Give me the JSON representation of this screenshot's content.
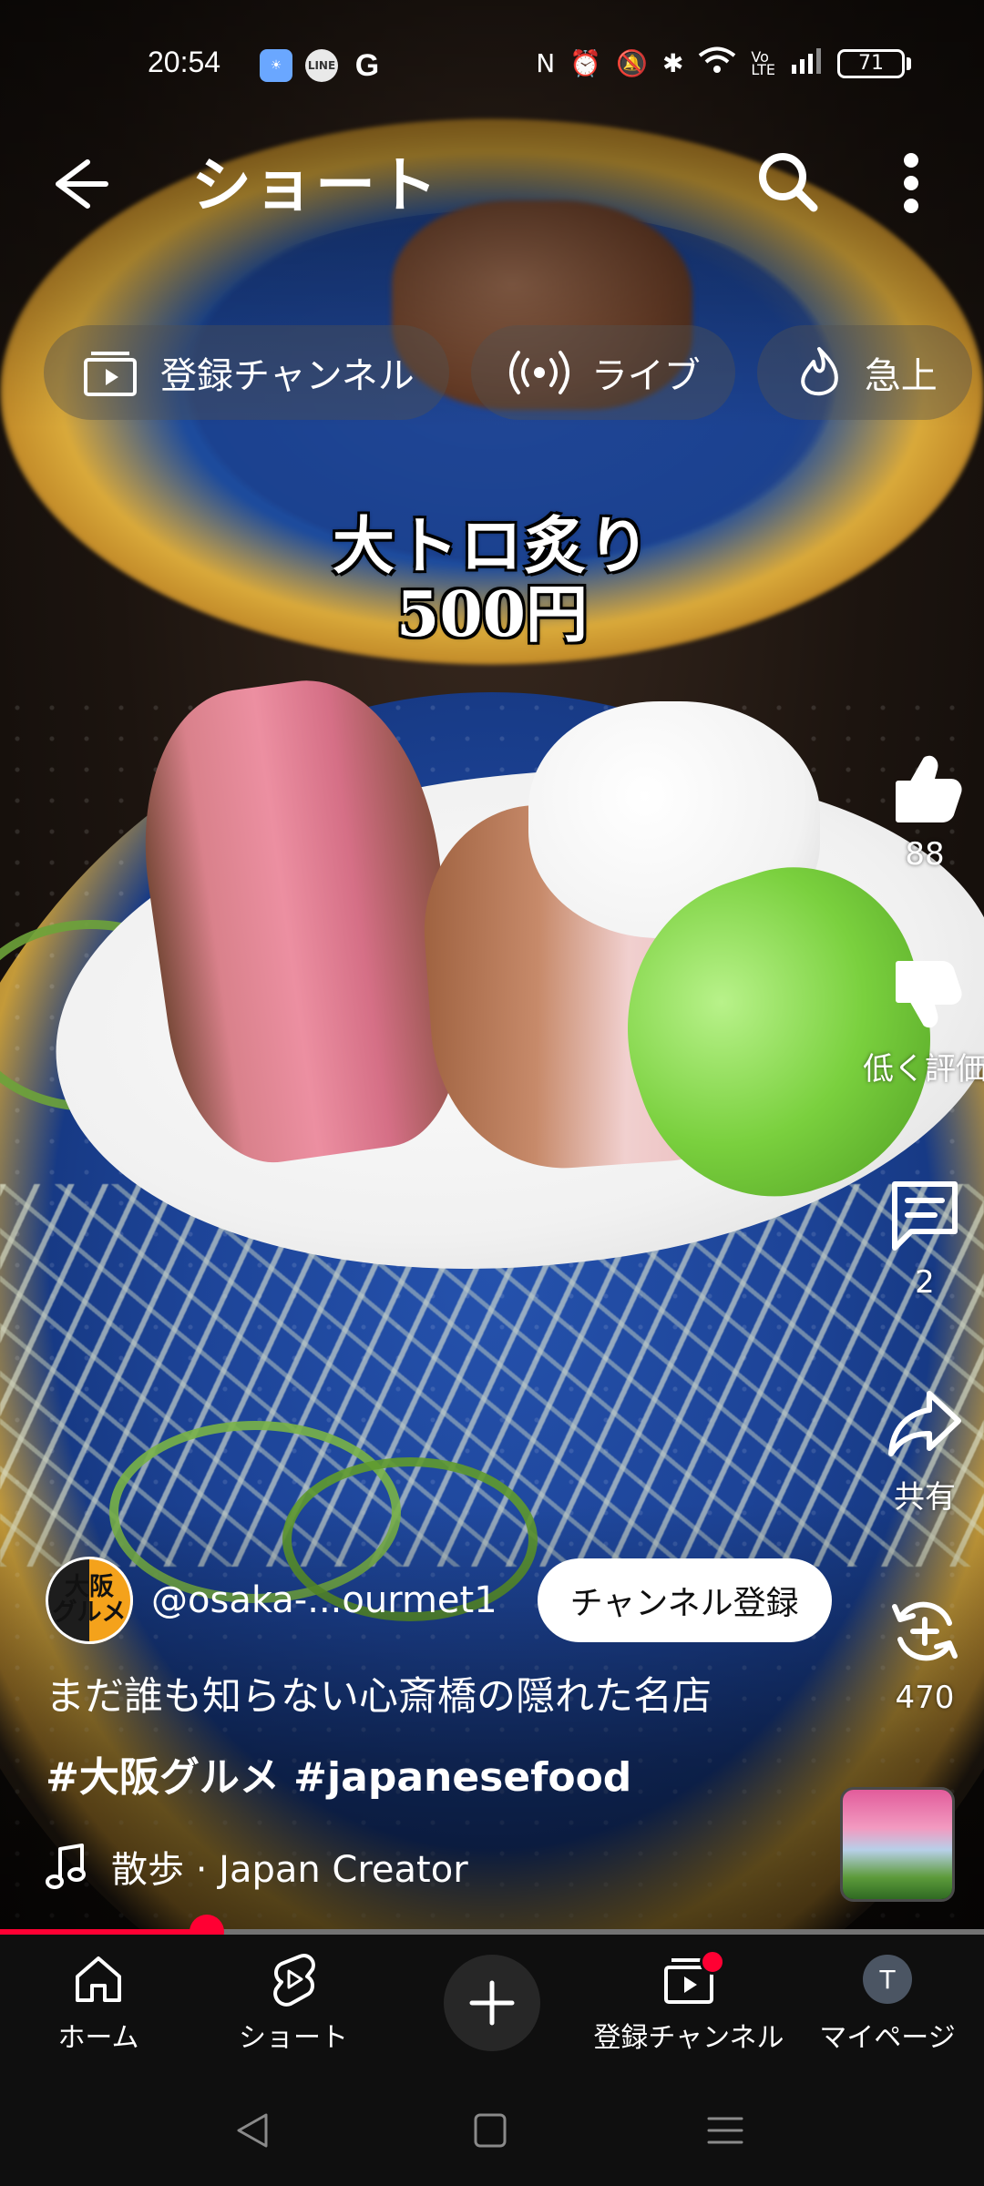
{
  "status_bar": {
    "time": "20:54",
    "notif_icons": [
      "weather-app",
      "LINE",
      "G"
    ],
    "battery_level": "71"
  },
  "header": {
    "title": "ショート"
  },
  "chips": [
    {
      "label": "登録チャンネル",
      "icon": "subscriptions-icon"
    },
    {
      "label": "ライブ",
      "icon": "live-icon"
    },
    {
      "label": "急上",
      "icon": "trending-icon"
    }
  ],
  "video_caption": {
    "line1": "大トロ炙り",
    "line2": "500円"
  },
  "actions": {
    "like_count": "88",
    "dislike_label": "低く評価",
    "comment_count": "2",
    "share_label": "共有",
    "remix_count": "470"
  },
  "channel": {
    "avatar_text": "大阪\nグルメ",
    "handle": "@osaka-...ourmet1",
    "subscribe_label": "チャンネル登録"
  },
  "description": "まだ誰も知らない心斎橋の隠れた名店",
  "hashtags": "#大阪グルメ #japanesefood",
  "music": "散歩 · Japan Creator",
  "progress_fraction": 0.21,
  "bottom_nav": {
    "home": "ホーム",
    "shorts": "ショート",
    "subscriptions": "登録チャンネル",
    "mypage": "マイページ",
    "avatar_initial": "T"
  },
  "colors": {
    "accent": "#ff0033",
    "nav_bg": "#0f0f0f"
  }
}
